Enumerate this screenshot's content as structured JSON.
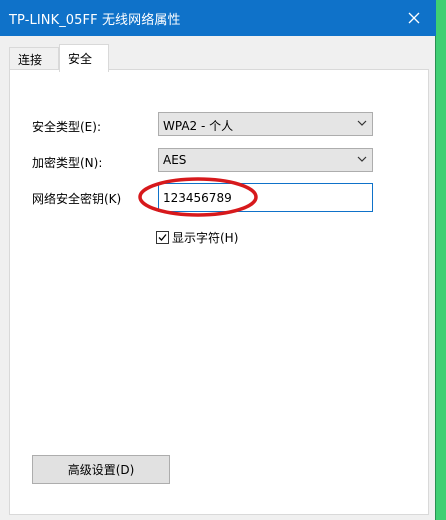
{
  "window": {
    "title": "TP-LINK_05FF 无线网络属性"
  },
  "tabs": [
    {
      "label": "连接"
    },
    {
      "label": "安全"
    }
  ],
  "form": {
    "security_type": {
      "label": "安全类型(E):",
      "value": "WPA2 - 个人"
    },
    "encryption_type": {
      "label": "加密类型(N):",
      "value": "AES"
    },
    "network_key": {
      "label": "网络安全密钥(K)",
      "value": "123456789"
    },
    "show_chars": {
      "label": "显示字符(H)",
      "checked": true
    }
  },
  "advanced_button": {
    "label": "高级设置(D)"
  },
  "colors": {
    "titlebar": "#0f72c9",
    "annotation": "#d7191c",
    "background": "#3fcf73"
  },
  "icons": {
    "close": "close-icon",
    "dropdown": "chevron-down-icon",
    "check": "checkmark-icon"
  }
}
